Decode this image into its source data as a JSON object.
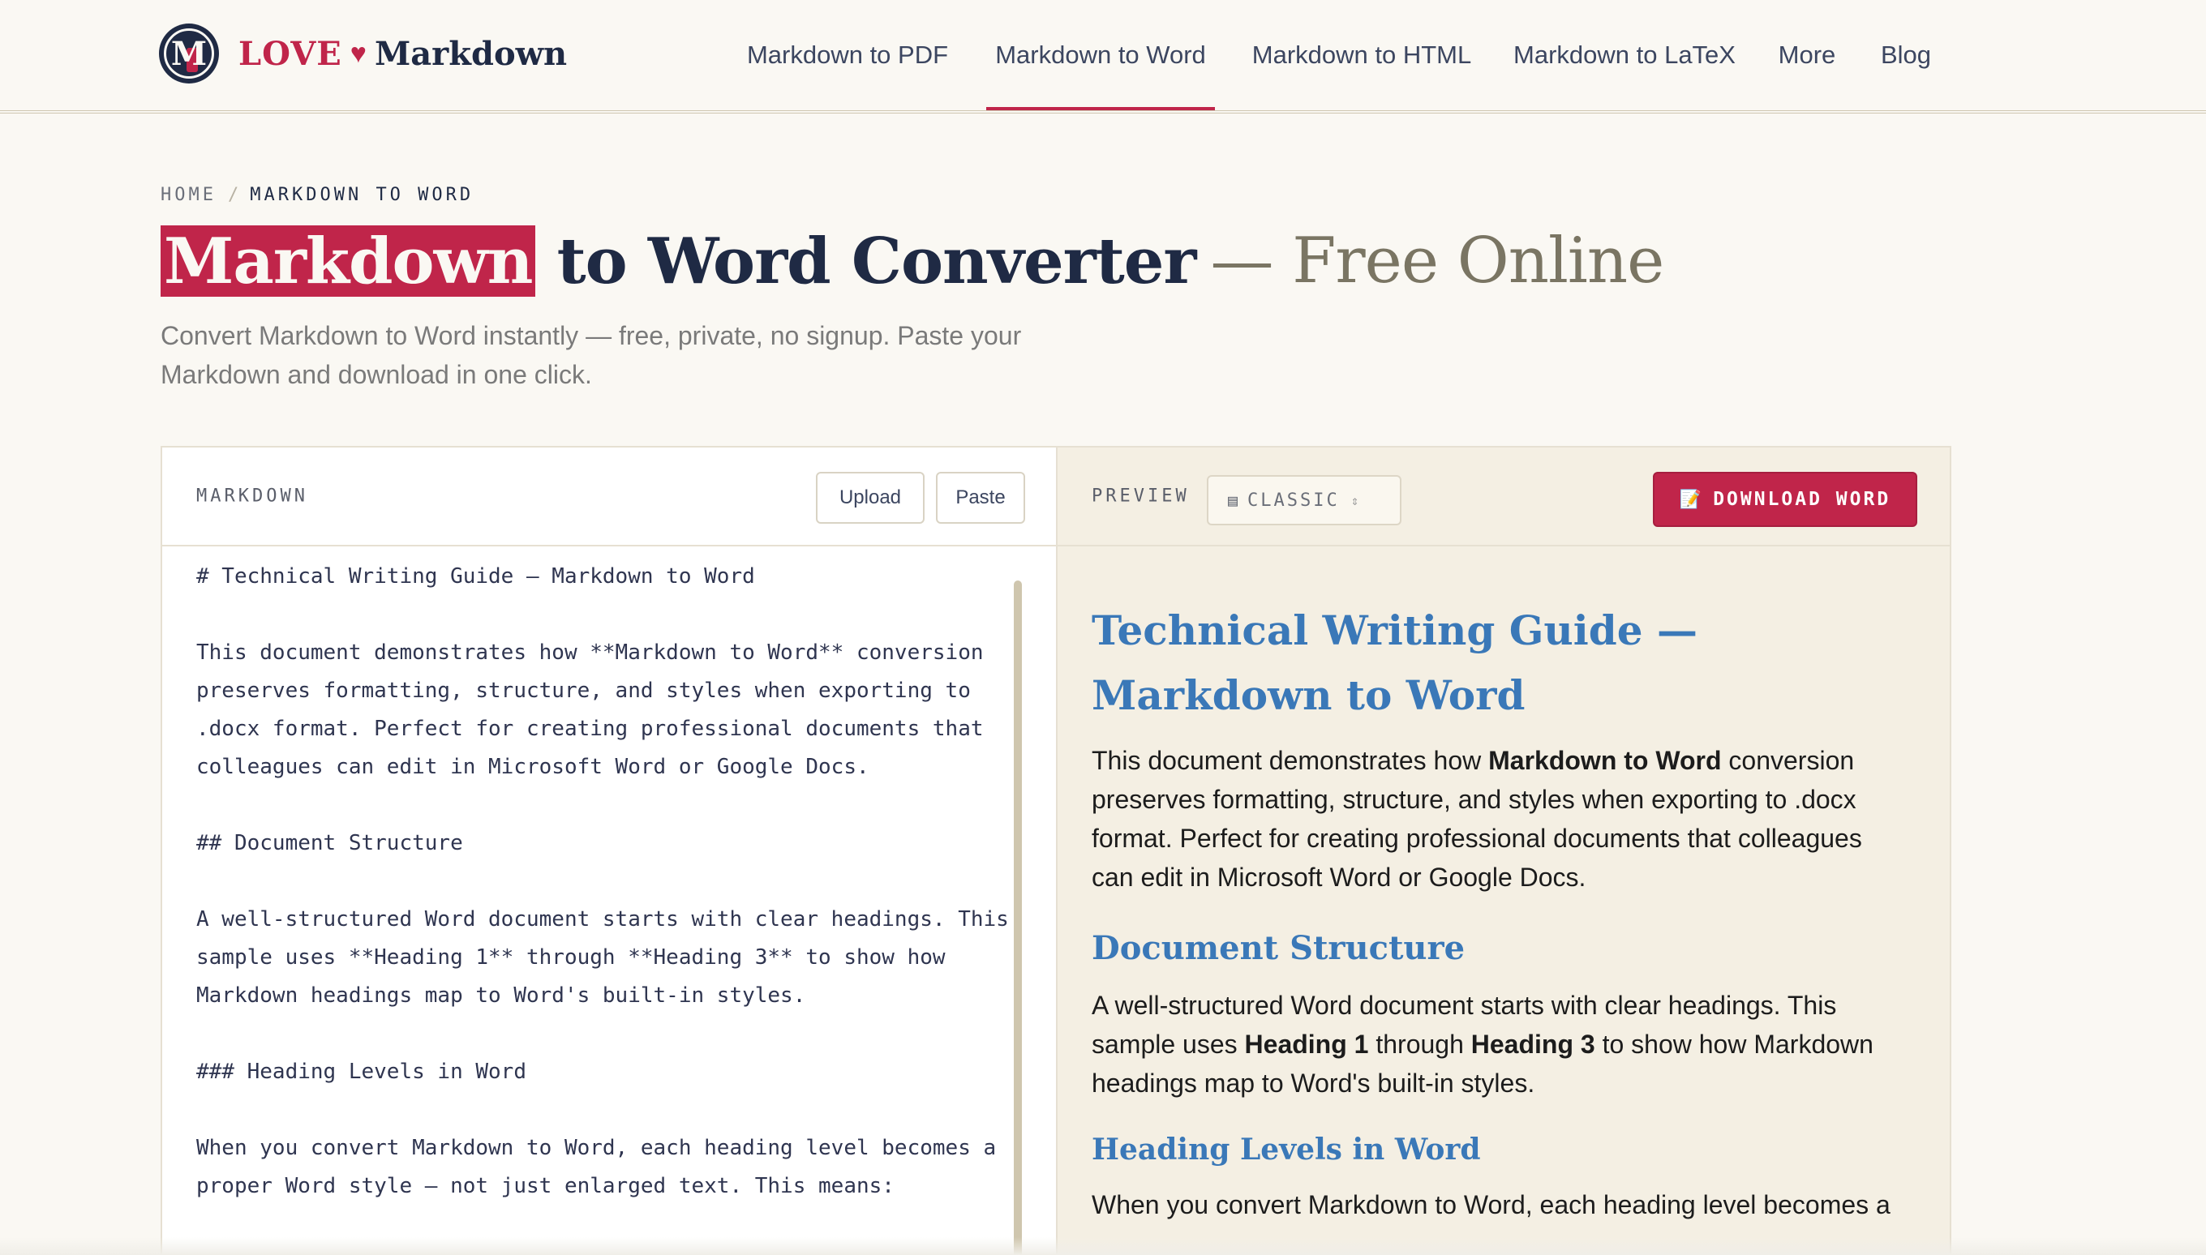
{
  "brand": {
    "logo_letter": "M",
    "love": "LOVE",
    "heart": "♥",
    "markdown": "Markdown",
    "accent_color": "#c0254a",
    "navy_color": "#1f2a44"
  },
  "nav": {
    "items": [
      {
        "label": "Markdown to PDF"
      },
      {
        "label": "Markdown to Word"
      },
      {
        "label": "Markdown to HTML"
      },
      {
        "label": "Markdown to LaTeX"
      },
      {
        "label": "More"
      },
      {
        "label": "Blog"
      }
    ],
    "active": "Markdown to Word"
  },
  "breadcrumb": {
    "home": "HOME",
    "separator": "/",
    "current": "MARKDOWN TO WORD"
  },
  "hero": {
    "title_highlight": "Markdown",
    "title_main": " to Word Converter",
    "title_tail": "— Free Online",
    "subtitle": "Convert Markdown to Word instantly — free, private, no signup. Paste your Markdown and download in one click."
  },
  "editor": {
    "label": "MARKDOWN",
    "upload_label": "Upload",
    "paste_label": "Paste",
    "content": "# Technical Writing Guide — Markdown to Word\n\nThis document demonstrates how **Markdown to Word** conversion preserves formatting, structure, and styles when exporting to .docx format. Perfect for creating professional documents that colleagues can edit in Microsoft Word or Google Docs.\n\n## Document Structure\n\nA well-structured Word document starts with clear headings. This sample uses **Heading 1** through **Heading 3** to show how Markdown headings map to Word's built-in styles.\n\n### Heading Levels in Word\n\nWhen you convert Markdown to Word, each heading level becomes a proper Word style — not just enlarged text. This means:"
  },
  "preview": {
    "label": "PREVIEW",
    "style_icon": "layout-icon",
    "style_value": "CLASSIC",
    "download_icon": "memo-icon",
    "download_label": "DOWNLOAD WORD",
    "h1": "Technical Writing Guide — Markdown to Word",
    "p1": {
      "before": "This document demonstrates how ",
      "bold": "Markdown to Word",
      "after": " conversion preserves formatting, structure, and styles when exporting to .docx format. Perfect for creating professional documents that colleagues can edit in Microsoft Word or Google Docs."
    },
    "h2": "Document Structure",
    "p2": {
      "a": "A well-structured Word document starts with clear headings. This sample uses ",
      "b1": "Heading 1",
      "c": " through ",
      "b2": "Heading 3",
      "d": " to show how Markdown headings map to Word's built-in styles."
    },
    "h3": "Heading Levels in Word",
    "p3": "When you convert Markdown to Word, each heading level becomes a",
    "heading_color": "#3a78b8"
  }
}
